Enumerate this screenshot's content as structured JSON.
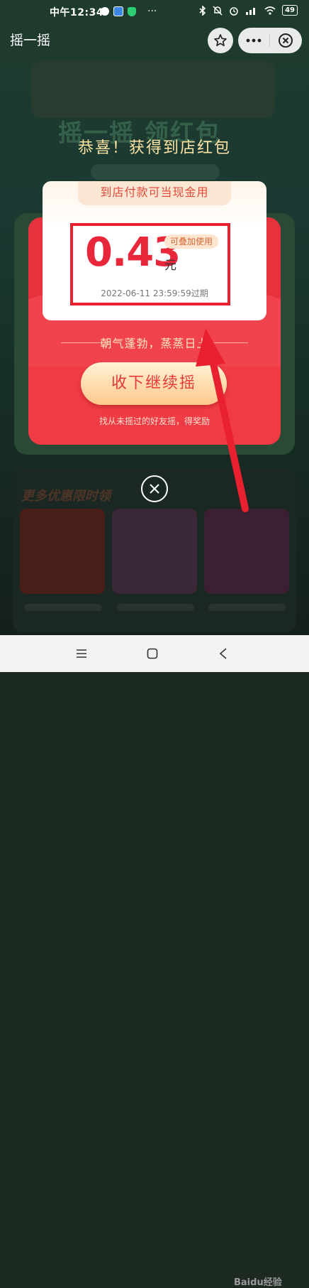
{
  "status_bar": {
    "time": "中午12:34",
    "more": "···",
    "battery": "49"
  },
  "header": {
    "title": "摇一摇"
  },
  "popup": {
    "congrats": "恭喜！获得到店红包",
    "coupon": {
      "headline": "到店付款可当现金用",
      "amount": "0.43",
      "unit": "元",
      "badge": "可叠加使用",
      "expiry": "2022-06-11 23:59:59过期"
    },
    "slogan": "朝气蓬勃，蒸蒸日上",
    "collect_button": "收下继续摇",
    "invite_tip": "找从未摇过的好友摇，得奖励"
  },
  "background": {
    "banner_title": "摇一摇 领红包",
    "section_title": "更多优惠限时领"
  },
  "watermark": "Baidu经验",
  "colors": {
    "envelope_red": "#f03b45",
    "amount_red": "#e8283a",
    "annotation_red": "#e8202f",
    "gold_text": "#ffe3a2"
  }
}
